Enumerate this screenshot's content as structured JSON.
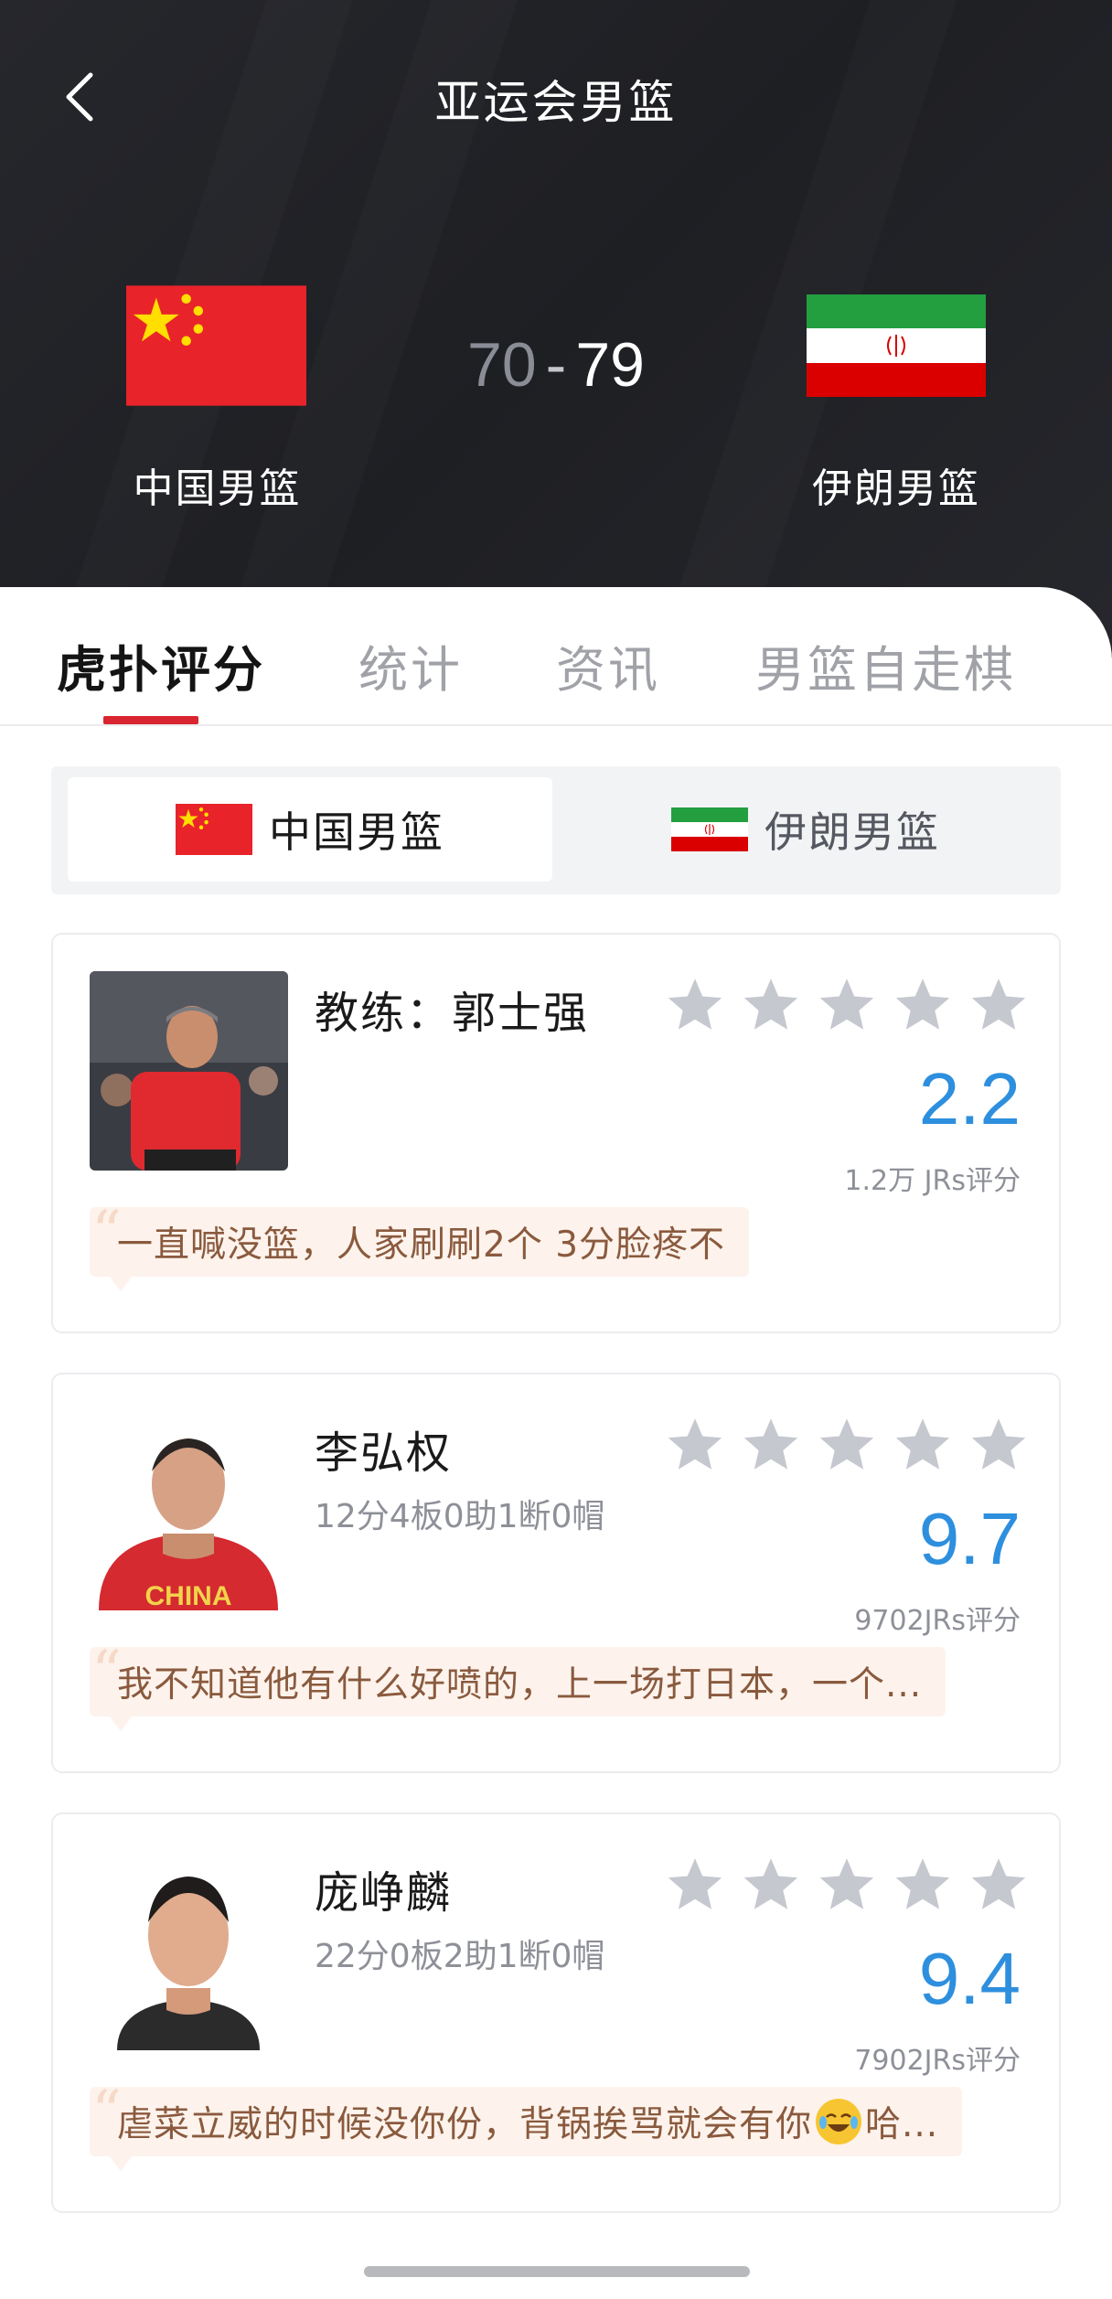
{
  "header": {
    "title": "亚运会男篮"
  },
  "match": {
    "home_team": "中国男篮",
    "away_team": "伊朗男篮",
    "home_score": "70",
    "separator": "-",
    "away_score": "79"
  },
  "tabs": [
    {
      "label": "虎扑评分",
      "active": true
    },
    {
      "label": "统计",
      "active": false
    },
    {
      "label": "资讯",
      "active": false
    },
    {
      "label": "男篮自走棋",
      "active": false
    }
  ],
  "team_switch": {
    "home_label": "中国男篮",
    "away_label": "伊朗男篮",
    "selected": "中国男篮"
  },
  "ratings": [
    {
      "name": "教练：郭士强",
      "stats": "",
      "stars": 5,
      "score": "2.2",
      "count": "1.2万 JRs评分",
      "comment": "一直喊没篮，人家刷刷2个 3分脸疼不"
    },
    {
      "name": "李弘权",
      "stats": "12分4板0助1断0帽",
      "stars": 5,
      "score": "9.7",
      "count": "9702JRs评分",
      "comment": "我不知道他有什么好喷的，上一场打日本，一个..."
    },
    {
      "name": "庞峥麟",
      "stats": "22分0板2助1断0帽",
      "stars": 5,
      "score": "9.4",
      "count": "7902JRs评分",
      "comment_before": "虐菜立威的时候没你份，背锅挨骂就会有你",
      "comment_after": "哈..."
    }
  ],
  "colors": {
    "header_bg": "#242529",
    "accent_red": "#d9252f",
    "score_blue": "#2d8fde",
    "star_gray": "#c6c8cf",
    "comment_bg": "#fdf3ec",
    "comment_text": "#8a5a3e"
  },
  "icons": {
    "back": "chevron-left-icon",
    "star": "star-icon",
    "china_flag": "china-flag-icon",
    "iran_flag": "iran-flag-icon",
    "emoji": "laughing-crying-emoji-icon"
  }
}
